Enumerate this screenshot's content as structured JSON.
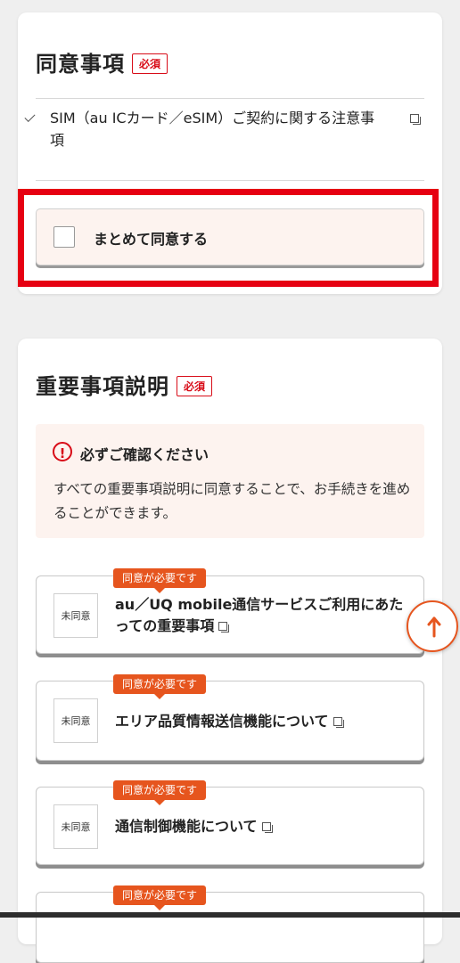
{
  "consent": {
    "title": "同意事項",
    "required_label": "必須",
    "item": {
      "text": "SIM（au ICカード／eSIM）ご契約に関する注意事項"
    },
    "agree_all_label": "まとめて同意する"
  },
  "important": {
    "title": "重要事項説明",
    "required_label": "必須",
    "notice": {
      "title": "必ずご確認ください",
      "body": "すべての重要事項説明に同意することで、お手続きを進めることができます。"
    },
    "items": [
      {
        "badge": "同意が必要です",
        "status": "未同意",
        "title": "au／UQ mobile通信サービスご利用にあたっての重要事項"
      },
      {
        "badge": "同意が必要です",
        "status": "未同意",
        "title": "エリア品質情報送信機能について"
      },
      {
        "badge": "同意が必要です",
        "status": "未同意",
        "title": "通信制御機能について"
      },
      {
        "badge": "同意が必要です",
        "status": "",
        "title": ""
      }
    ]
  },
  "colors": {
    "accent": "#e6551e",
    "required": "#d80c18",
    "highlight": "#e60012",
    "notice_bg": "#fdf3ef"
  },
  "icons": {
    "check": "checkmark-icon",
    "external": "external-window-icon",
    "alert": "exclamation-circle-icon",
    "scroll": "arrow-up-icon"
  }
}
